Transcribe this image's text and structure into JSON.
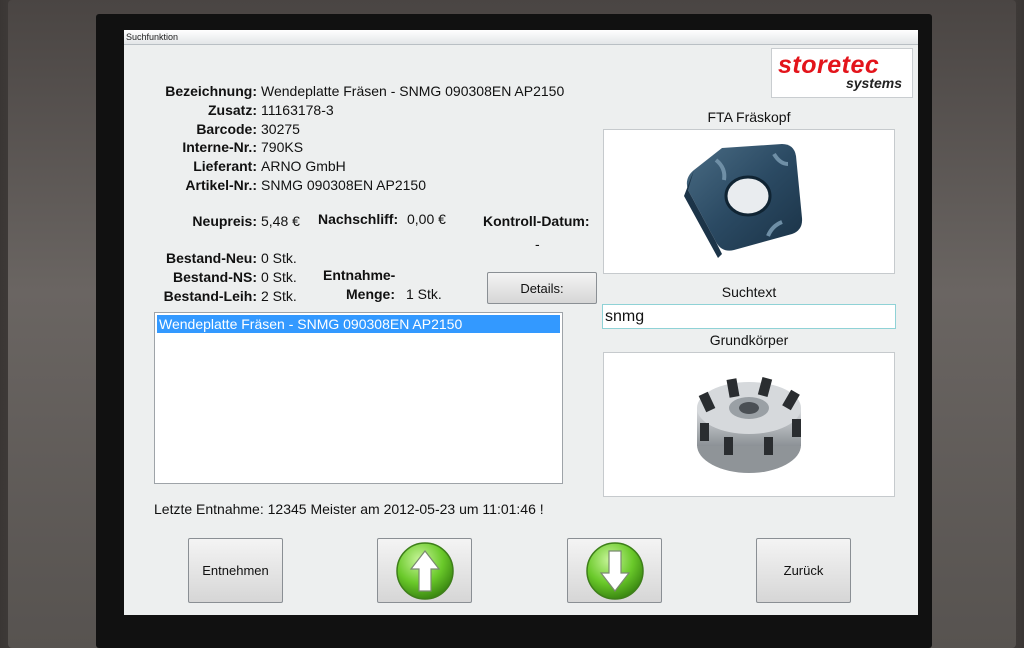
{
  "window": {
    "title": "Suchfunktion"
  },
  "logo": {
    "line1": "storetec",
    "line2": "systems"
  },
  "details_fields": [
    {
      "label": "Bezeichnung:",
      "value": "Wendeplatte Fräsen - SNMG 090308EN AP2150"
    },
    {
      "label": "Zusatz:",
      "value": "11163178-3"
    },
    {
      "label": "Barcode:",
      "value": "30275"
    },
    {
      "label": "Interne-Nr.:",
      "value": "790KS"
    },
    {
      "label": "Lieferant:",
      "value": "ARNO GmbH"
    },
    {
      "label": "Artikel-Nr.:",
      "value": "SNMG 090308EN AP2150"
    }
  ],
  "prices": {
    "neupreis_label": "Neupreis:",
    "neupreis_value": "5,48 €",
    "nachschliff_label": "Nachschliff:",
    "nachschliff_value": "0,00 €",
    "kontroll_label": "Kontroll-Datum:",
    "kontroll_value": "-"
  },
  "stock": [
    {
      "label": "Bestand-Neu:",
      "value": "0 Stk."
    },
    {
      "label": "Bestand-NS:",
      "value": "0 Stk."
    },
    {
      "label": "Bestand-Leih:",
      "value": "2 Stk."
    }
  ],
  "entnahme": {
    "label_line1": "Entnahme-",
    "label_line2": "Menge:",
    "value": "1 Stk."
  },
  "details_button": "Details:",
  "right_panel": {
    "image1_title": "FTA Fräskopf",
    "search_label": "Suchtext",
    "search_value": "snmg",
    "image2_title": "Grundkörper"
  },
  "results": [
    "Wendeplatte Fräsen - SNMG 090308EN AP2150"
  ],
  "last_withdrawal": "Letzte Entnahme: 12345 Meister am 2012-05-23 um 11:01:46 !",
  "bottom_buttons": {
    "take": "Entnehmen",
    "back": "Zurück"
  },
  "colors": {
    "accent_red": "#e3141b",
    "selection_blue": "#3399ff",
    "arrow_green": "#6ac92a"
  },
  "icons": {
    "up": "arrow-up-icon",
    "down": "arrow-down-icon"
  }
}
